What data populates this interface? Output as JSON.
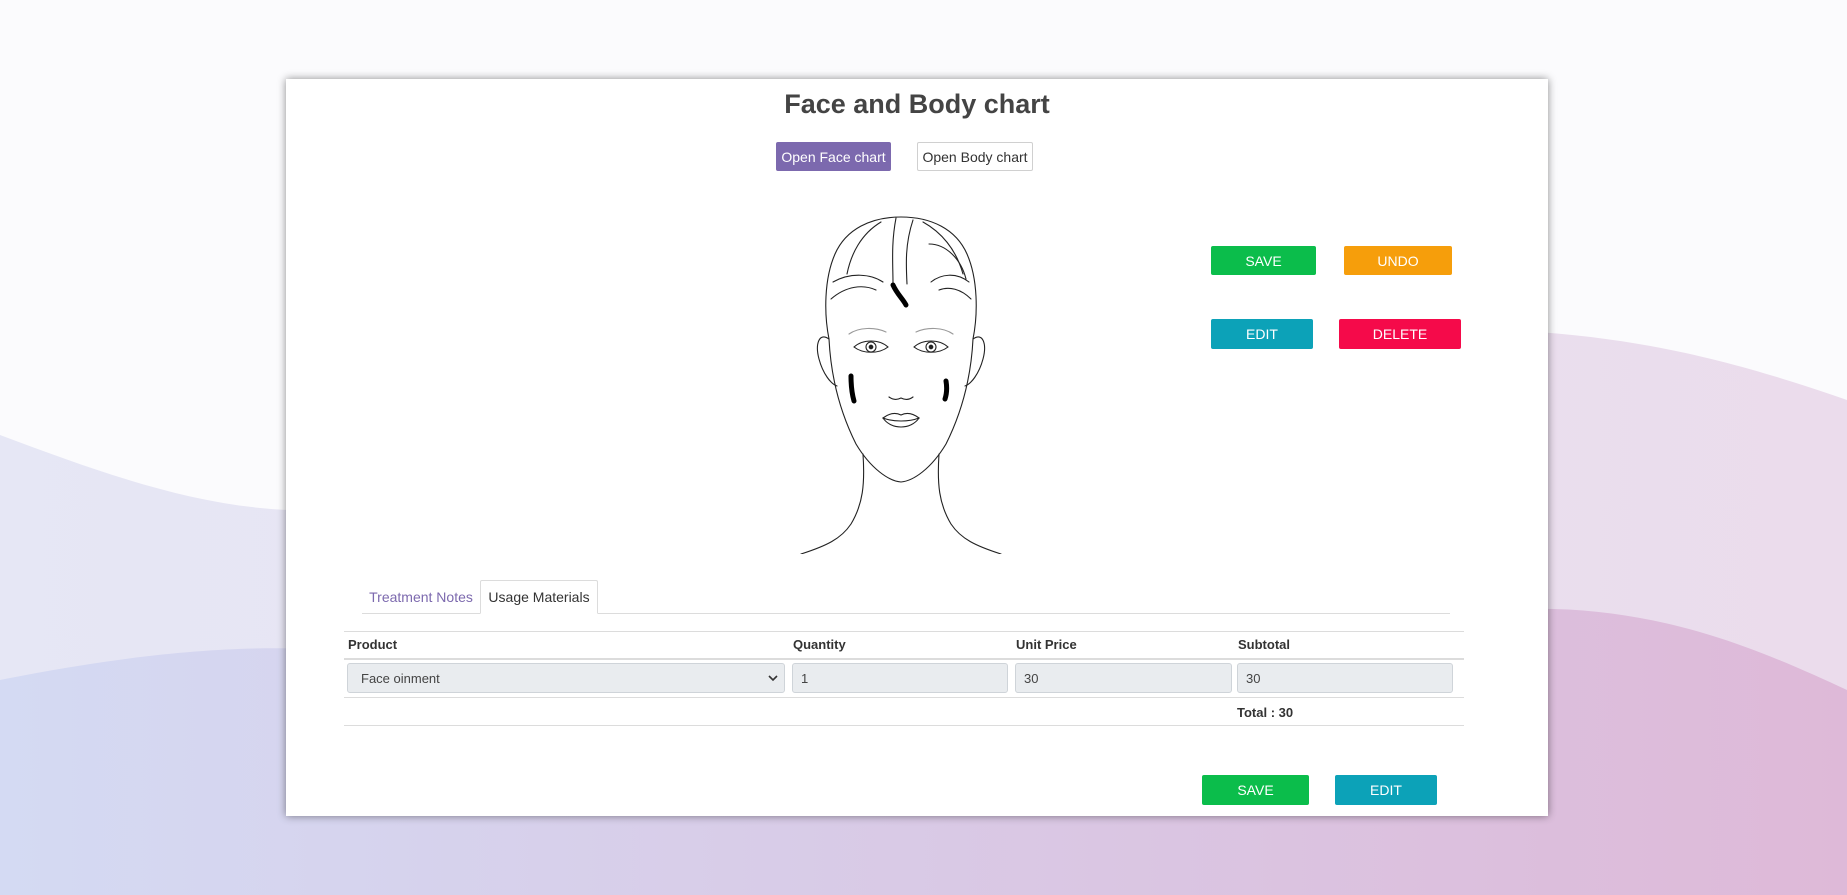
{
  "page": {
    "title": "Face and Body chart"
  },
  "chart_buttons": {
    "face": "Open Face chart",
    "body": "Open Body chart"
  },
  "canvas_controls": {
    "save": "SAVE",
    "undo": "UNDO",
    "edit": "EDIT",
    "delete": "DELETE"
  },
  "tabs": [
    {
      "label": "Treatment Notes",
      "active": false
    },
    {
      "label": "Usage Materials",
      "active": true
    }
  ],
  "table": {
    "headers": [
      "Product",
      "Quantity",
      "Unit Price",
      "Subtotal"
    ],
    "rows": [
      {
        "product": "Face oinment",
        "quantity": "1",
        "unit_price": "30",
        "subtotal": "30"
      }
    ],
    "total": "Total : 30"
  },
  "footer_actions": {
    "save": "SAVE",
    "edit": "EDIT"
  },
  "colors": {
    "primary": "#7c69ae",
    "save": "#0bbd4b",
    "undo": "#f69e0b",
    "edit": "#0ca2b8",
    "delete": "#f50a4a"
  }
}
